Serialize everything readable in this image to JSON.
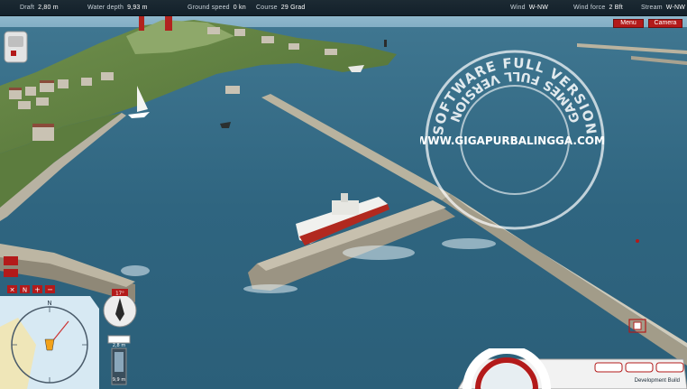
{
  "hud": {
    "draft_label": "Draft",
    "draft_value": "2,80 m",
    "water_depth_label": "Water depth",
    "water_depth_value": "9,93 m",
    "ground_speed_label": "Ground speed",
    "ground_speed_value": "0 kn",
    "course_label": "Course",
    "course_value": "29 Grad",
    "wind_label": "Wind",
    "wind_value": "W-NW",
    "wind_force_label": "Wind force",
    "wind_force_value": "2 Bft",
    "stream_label": "Stream",
    "stream_value": "W-NW"
  },
  "buttons": {
    "menu": "Menu",
    "camera": "Camera"
  },
  "minimap": {
    "north_label": "N",
    "toolbar_n": "N",
    "heading_label": "17°",
    "depth_top": "2,8 m",
    "depth_bottom": "9,9 m"
  },
  "watermark": {
    "top": "SOFTWARE FULL VERSION",
    "middle": "WWW.GIGAPURBALINGGA.COM",
    "bottom": "GAMES FULL VERSION"
  },
  "footer": {
    "dev_build": "Development Build"
  },
  "colors": {
    "water": "#2f5d72",
    "hud_accent": "#b31a1a"
  }
}
